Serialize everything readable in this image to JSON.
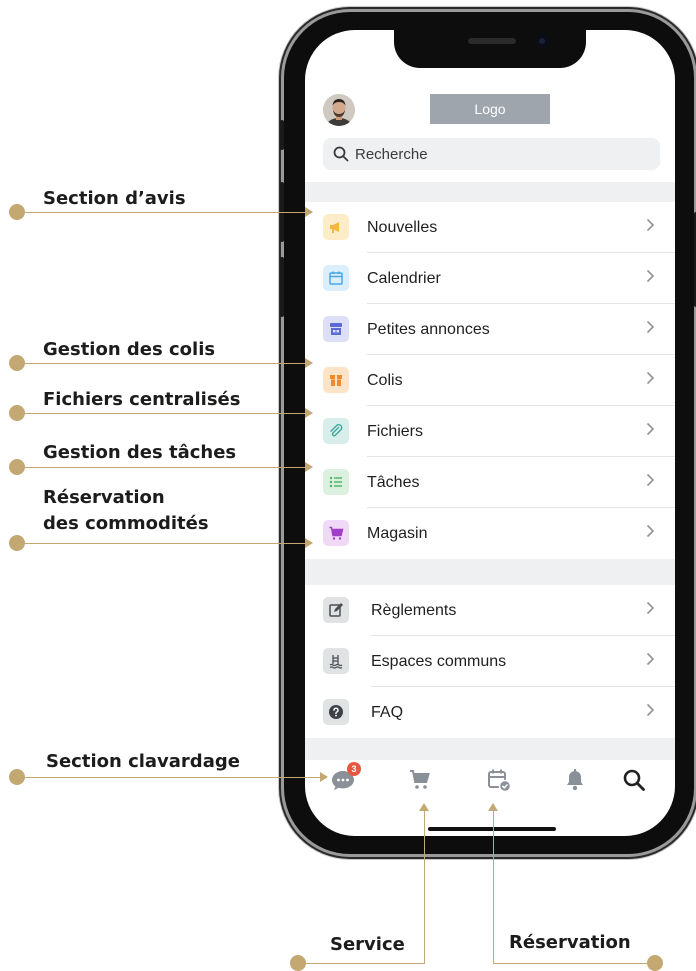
{
  "callouts": {
    "avis": "Section d’avis",
    "colis": "Gestion des colis",
    "fichiers": "Fichiers centralisés",
    "taches": "Gestion des tâches",
    "reservation_line1": "Réservation",
    "reservation_line2": "des commodités",
    "clavardage": "Section clavardage",
    "service": "Service",
    "reservation_bottom": "Réservation"
  },
  "header": {
    "logo_text": "Logo",
    "search_placeholder": "Recherche"
  },
  "menu_main": [
    {
      "label": "Nouvelles",
      "icon": "megaphone-icon",
      "color": "#f4b63c"
    },
    {
      "label": "Calendrier",
      "icon": "calendar-icon",
      "color": "#4aa7e8"
    },
    {
      "label": "Petites annonces",
      "icon": "store-icon",
      "color": "#5b6bd6"
    },
    {
      "label": "Colis",
      "icon": "package-icon",
      "color": "#f08a2c"
    },
    {
      "label": "Fichiers",
      "icon": "paperclip-icon",
      "color": "#3fa69a"
    },
    {
      "label": "Tâches",
      "icon": "checklist-icon",
      "color": "#4bb462"
    },
    {
      "label": "Magasin",
      "icon": "cart-icon",
      "color": "#a13fc7"
    }
  ],
  "menu_secondary": [
    {
      "label": "Règlements",
      "icon": "edit-document-icon",
      "color": "#6b6f76"
    },
    {
      "label": "Espaces communs",
      "icon": "pool-icon",
      "color": "#6b6f76"
    },
    {
      "label": "FAQ",
      "icon": "question-icon",
      "color": "#4a4e55"
    }
  ],
  "tabbar": {
    "chat_badge": "3",
    "tabs": [
      "chat-icon",
      "cart-icon",
      "calendar-check-icon",
      "bell-icon",
      "search-icon"
    ]
  },
  "colors": {
    "accent_gold": "#c4a872",
    "badge_red": "#e8563f",
    "icon_gray": "#8a9097"
  }
}
